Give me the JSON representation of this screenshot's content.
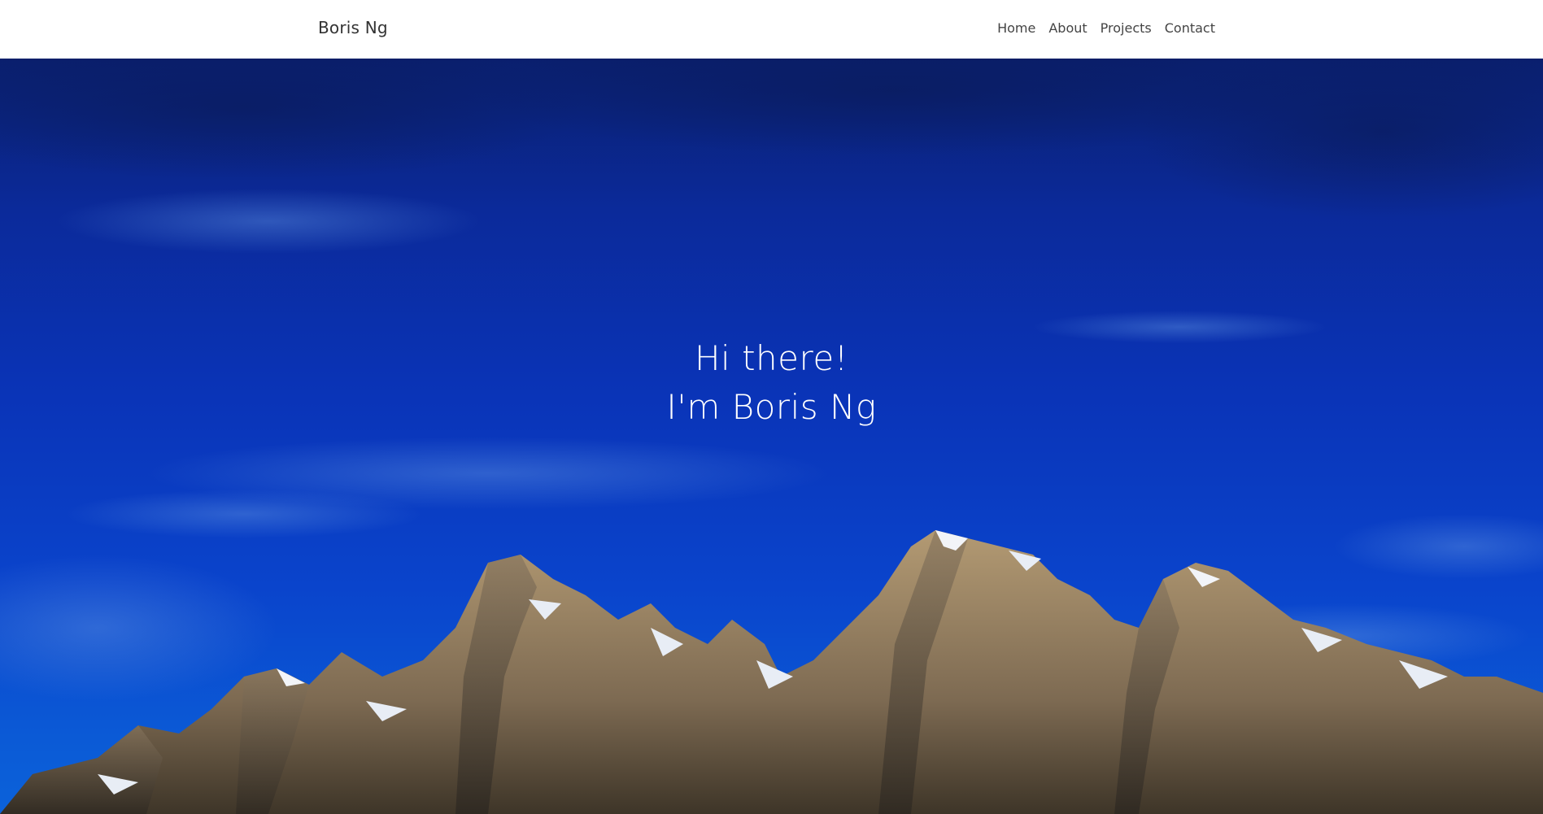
{
  "navbar": {
    "brand": "Boris Ng",
    "links": [
      {
        "label": "Home"
      },
      {
        "label": "About"
      },
      {
        "label": "Projects"
      },
      {
        "label": "Contact"
      }
    ]
  },
  "hero": {
    "line1": "Hi there!",
    "line2": "I'm Boris Ng",
    "background": "mountain-sky-photo"
  },
  "colors": {
    "navbar_bg": "#ffffff",
    "brand_text": "#333333",
    "link_text": "#444444",
    "sky_dark": "#0a1f6e",
    "sky_mid": "#0a34b8",
    "sky_light": "#0b62da",
    "hero_text": "#ffffff"
  }
}
